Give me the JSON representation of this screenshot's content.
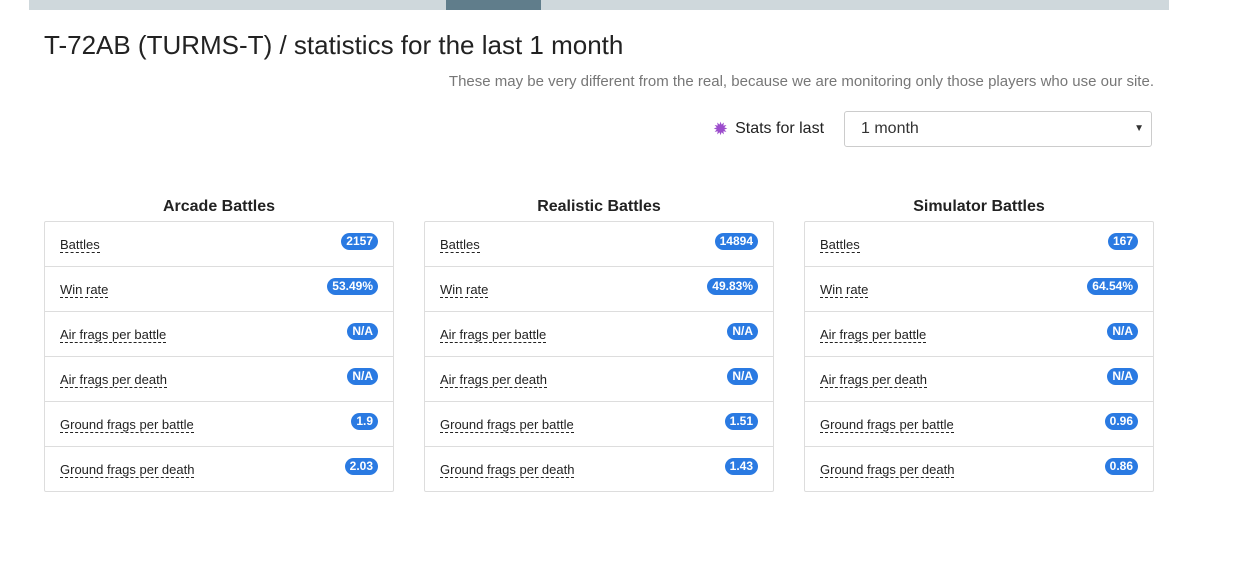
{
  "page": {
    "title": "T-72AB (TURMS-T) / statistics for the last 1 month",
    "subtitle": "These may be very different from the real, because we are monitoring only those players who use our site."
  },
  "filter": {
    "label": "Stats for last",
    "icon": "cog-icon",
    "icon_color": "#9c4dcc",
    "selected": "1 month"
  },
  "colors": {
    "badge": "#2a7ae2",
    "topbar": "#cfd8dc",
    "topbar_active": "#607d8b"
  },
  "panels": [
    {
      "title": "Arcade Battles",
      "rows": [
        {
          "label": "Battles",
          "value": "2157"
        },
        {
          "label": "Win rate",
          "value": "53.49%"
        },
        {
          "label": "Air frags per battle",
          "value": "N/A"
        },
        {
          "label": "Air frags per death",
          "value": "N/A"
        },
        {
          "label": "Ground frags per battle",
          "value": "1.9"
        },
        {
          "label": "Ground frags per death",
          "value": "2.03"
        }
      ]
    },
    {
      "title": "Realistic Battles",
      "rows": [
        {
          "label": "Battles",
          "value": "14894"
        },
        {
          "label": "Win rate",
          "value": "49.83%"
        },
        {
          "label": "Air frags per battle",
          "value": "N/A"
        },
        {
          "label": "Air frags per death",
          "value": "N/A"
        },
        {
          "label": "Ground frags per battle",
          "value": "1.51"
        },
        {
          "label": "Ground frags per death",
          "value": "1.43"
        }
      ]
    },
    {
      "title": "Simulator Battles",
      "rows": [
        {
          "label": "Battles",
          "value": "167"
        },
        {
          "label": "Win rate",
          "value": "64.54%"
        },
        {
          "label": "Air frags per battle",
          "value": "N/A"
        },
        {
          "label": "Air frags per death",
          "value": "N/A"
        },
        {
          "label": "Ground frags per battle",
          "value": "0.96"
        },
        {
          "label": "Ground frags per death",
          "value": "0.86"
        }
      ]
    }
  ]
}
